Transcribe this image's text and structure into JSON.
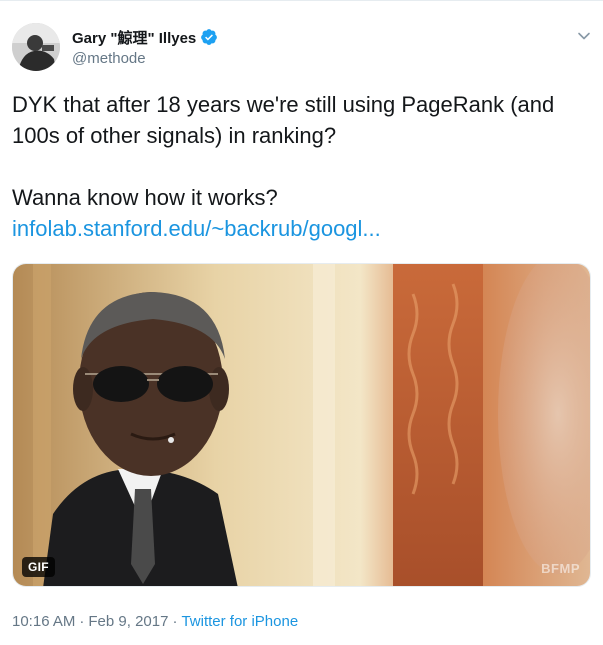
{
  "author": {
    "display_name": "Gary \"鯨理\" Illyes",
    "handle": "@methode",
    "verified": true
  },
  "tweet": {
    "line1": "DYK that after 18 years we're still using PageRank (and 100s of other signals) in ranking?",
    "line2": "Wanna know how it works?",
    "link_text": "infolab.stanford.edu/~backrub/googl..."
  },
  "media": {
    "badge": "GIF",
    "watermark": "BFMP"
  },
  "meta": {
    "time": "10:16 AM",
    "separator": "·",
    "date": "Feb 9, 2017",
    "source": "Twitter for iPhone"
  },
  "icons": {
    "verified": "verified-badge-icon",
    "caret": "chevron-down-icon"
  },
  "colors": {
    "link": "#1b95e0",
    "verified": "#1da1f2",
    "secondary_text": "#657786"
  }
}
